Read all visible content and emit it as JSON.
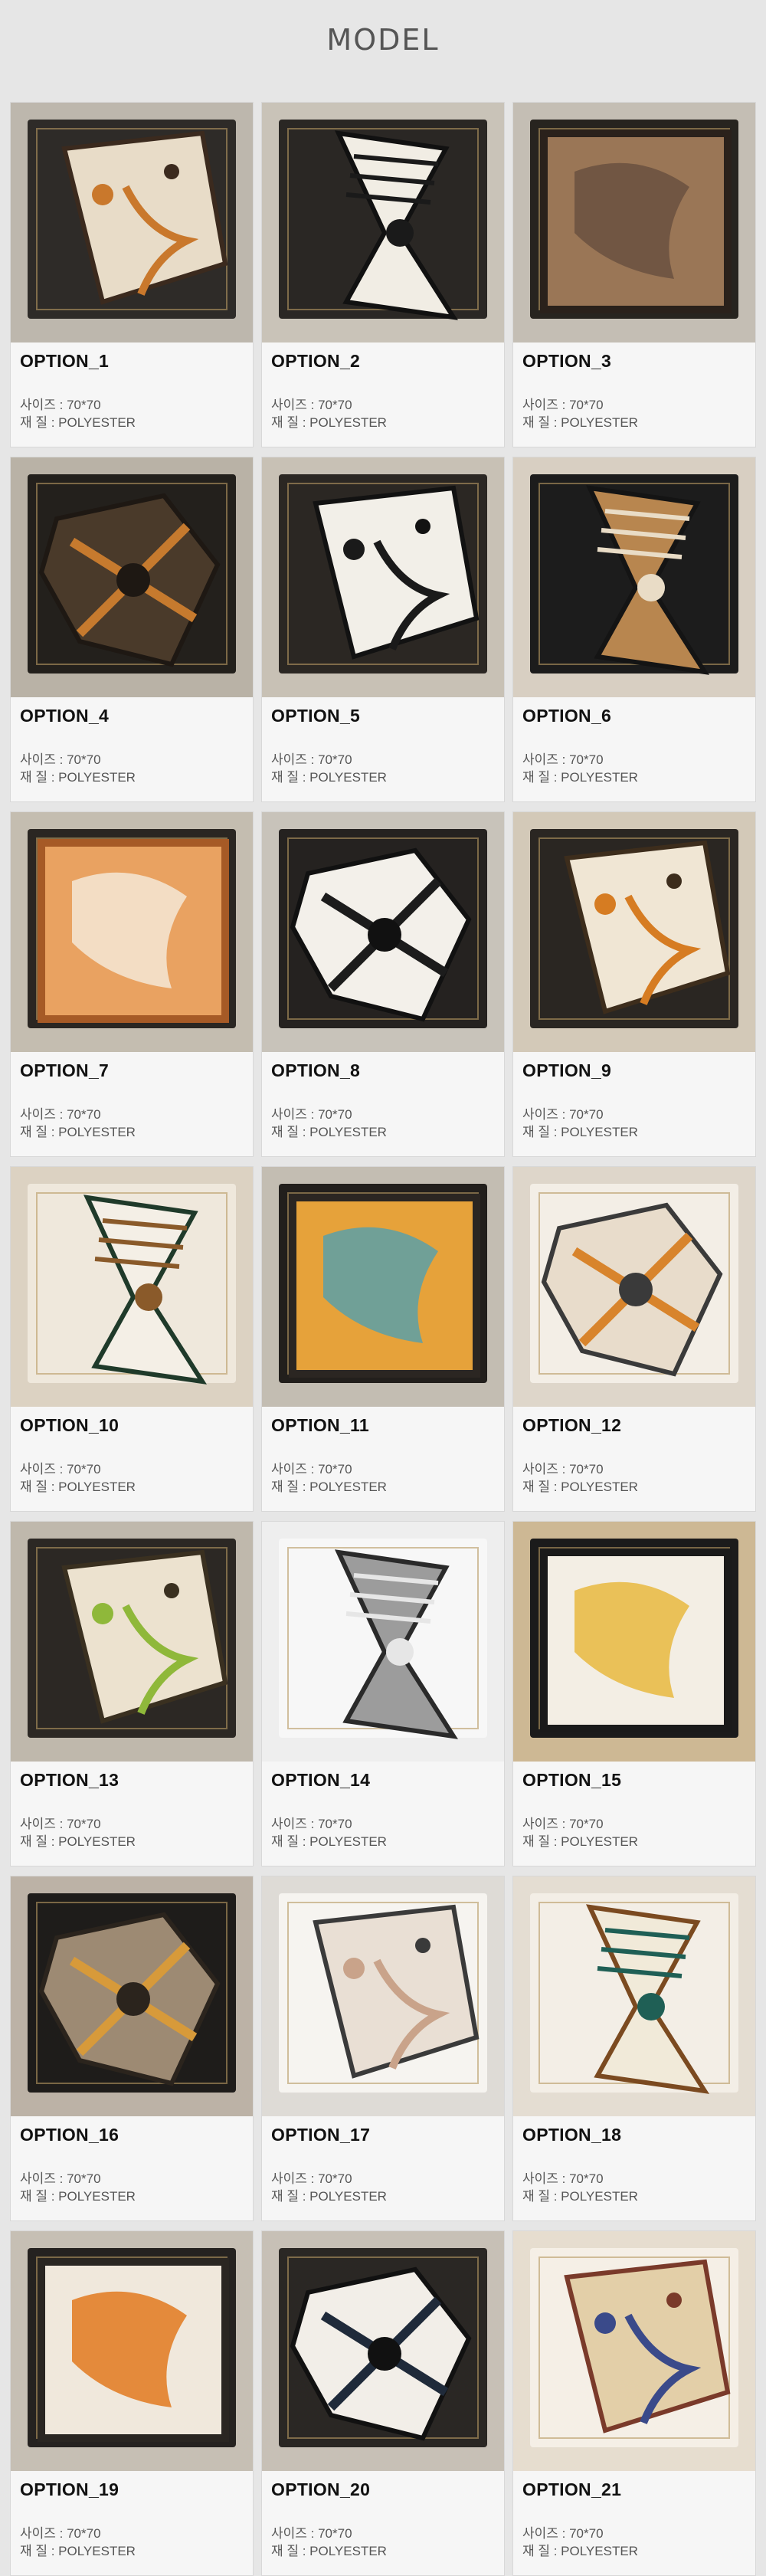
{
  "header": {
    "title": "MODEL"
  },
  "spec_labels": {
    "size": "사이즈 : 70*70",
    "material": "재    질 : POLYESTER"
  },
  "options": [
    {
      "label": "OPTION_1",
      "bg": "#bdb7ad",
      "tray": "#2e2b28",
      "scarf": "#e8dcc8",
      "accent": "#c9782c",
      "dark": "#3b2a1e"
    },
    {
      "label": "OPTION_2",
      "bg": "#c9c3b8",
      "tray": "#2a2724",
      "scarf": "#f1ede4",
      "accent": "#1a1a1a",
      "dark": "#111111"
    },
    {
      "label": "OPTION_3",
      "bg": "#c4beb4",
      "tray": "#27241f",
      "scarf": "#9a7656",
      "accent": "#6a5140",
      "dark": "#2a211b"
    },
    {
      "label": "OPTION_4",
      "bg": "#b9b2a6",
      "tray": "#23201c",
      "scarf": "#4a3a2a",
      "accent": "#c67a2e",
      "dark": "#1e1813"
    },
    {
      "label": "OPTION_5",
      "bg": "#c8c1b5",
      "tray": "#2b2723",
      "scarf": "#f2efe8",
      "accent": "#1a1a1a",
      "dark": "#121212"
    },
    {
      "label": "OPTION_6",
      "bg": "#d8cfc2",
      "tray": "#1c1c1c",
      "scarf": "#b8864f",
      "accent": "#e9dcc6",
      "dark": "#141414"
    },
    {
      "label": "OPTION_7",
      "bg": "#c4bdb0",
      "tray": "#2a2622",
      "scarf": "#e9a261",
      "accent": "#f4e7d6",
      "dark": "#a65a26"
    },
    {
      "label": "OPTION_8",
      "bg": "#c8c3ba",
      "tray": "#252220",
      "scarf": "#f3f0ea",
      "accent": "#1c1c1c",
      "dark": "#111111"
    },
    {
      "label": "OPTION_9",
      "bg": "#d3c9b8",
      "tray": "#2a2622",
      "scarf": "#f0e6d4",
      "accent": "#d67c22",
      "dark": "#3d2d1c"
    },
    {
      "label": "OPTION_10",
      "bg": "#dcd2c2",
      "tray": "#efe8dc",
      "scarf": "#f4efe6",
      "accent": "#8a5a2a",
      "dark": "#1f3a2a"
    },
    {
      "label": "OPTION_11",
      "bg": "#c3bdb2",
      "tray": "#221f1c",
      "scarf": "#e6a23a",
      "accent": "#5aa0a8",
      "dark": "#2b2622"
    },
    {
      "label": "OPTION_12",
      "bg": "#ded6ca",
      "tray": "#f3eee6",
      "scarf": "#e8dccb",
      "accent": "#d8842c",
      "dark": "#3a3a3a"
    },
    {
      "label": "OPTION_13",
      "bg": "#bfb8ac",
      "tray": "#2c2824",
      "scarf": "#ece2cf",
      "accent": "#8fb83a",
      "dark": "#3a3020"
    },
    {
      "label": "OPTION_14",
      "bg": "#eeeeee",
      "tray": "#f7f7f7",
      "scarf": "#9c9c9c",
      "accent": "#e6e6e6",
      "dark": "#2a2a2a"
    },
    {
      "label": "OPTION_15",
      "bg": "#cdb894",
      "tray": "#1b1b1b",
      "scarf": "#f3eee4",
      "accent": "#e8b840",
      "dark": "#1a1a1a"
    },
    {
      "label": "OPTION_16",
      "bg": "#bcb2a6",
      "tray": "#1e1c1a",
      "scarf": "#9d8a73",
      "accent": "#d79a3a",
      "dark": "#2b241d"
    },
    {
      "label": "OPTION_17",
      "bg": "#dedbd6",
      "tray": "#f6f4f0",
      "scarf": "#e9dfd4",
      "accent": "#c9a38a",
      "dark": "#3a3a3a"
    },
    {
      "label": "OPTION_18",
      "bg": "#e4ddd2",
      "tray": "#f3eee6",
      "scarf": "#f1ead9",
      "accent": "#1f5f55",
      "dark": "#7b4a20"
    },
    {
      "label": "OPTION_19",
      "bg": "#c6bfb4",
      "tray": "#252220",
      "scarf": "#f0e8dc",
      "accent": "#e2791f",
      "dark": "#2a2622"
    },
    {
      "label": "OPTION_20",
      "bg": "#c7c0b6",
      "tray": "#2a2724",
      "scarf": "#f2eee8",
      "accent": "#1f2a3a",
      "dark": "#111111"
    },
    {
      "label": "OPTION_21",
      "bg": "#e6ddcf",
      "tray": "#f5efe6",
      "scarf": "#e3cfa8",
      "accent": "#3a4a8a",
      "dark": "#7a3a2a"
    }
  ]
}
